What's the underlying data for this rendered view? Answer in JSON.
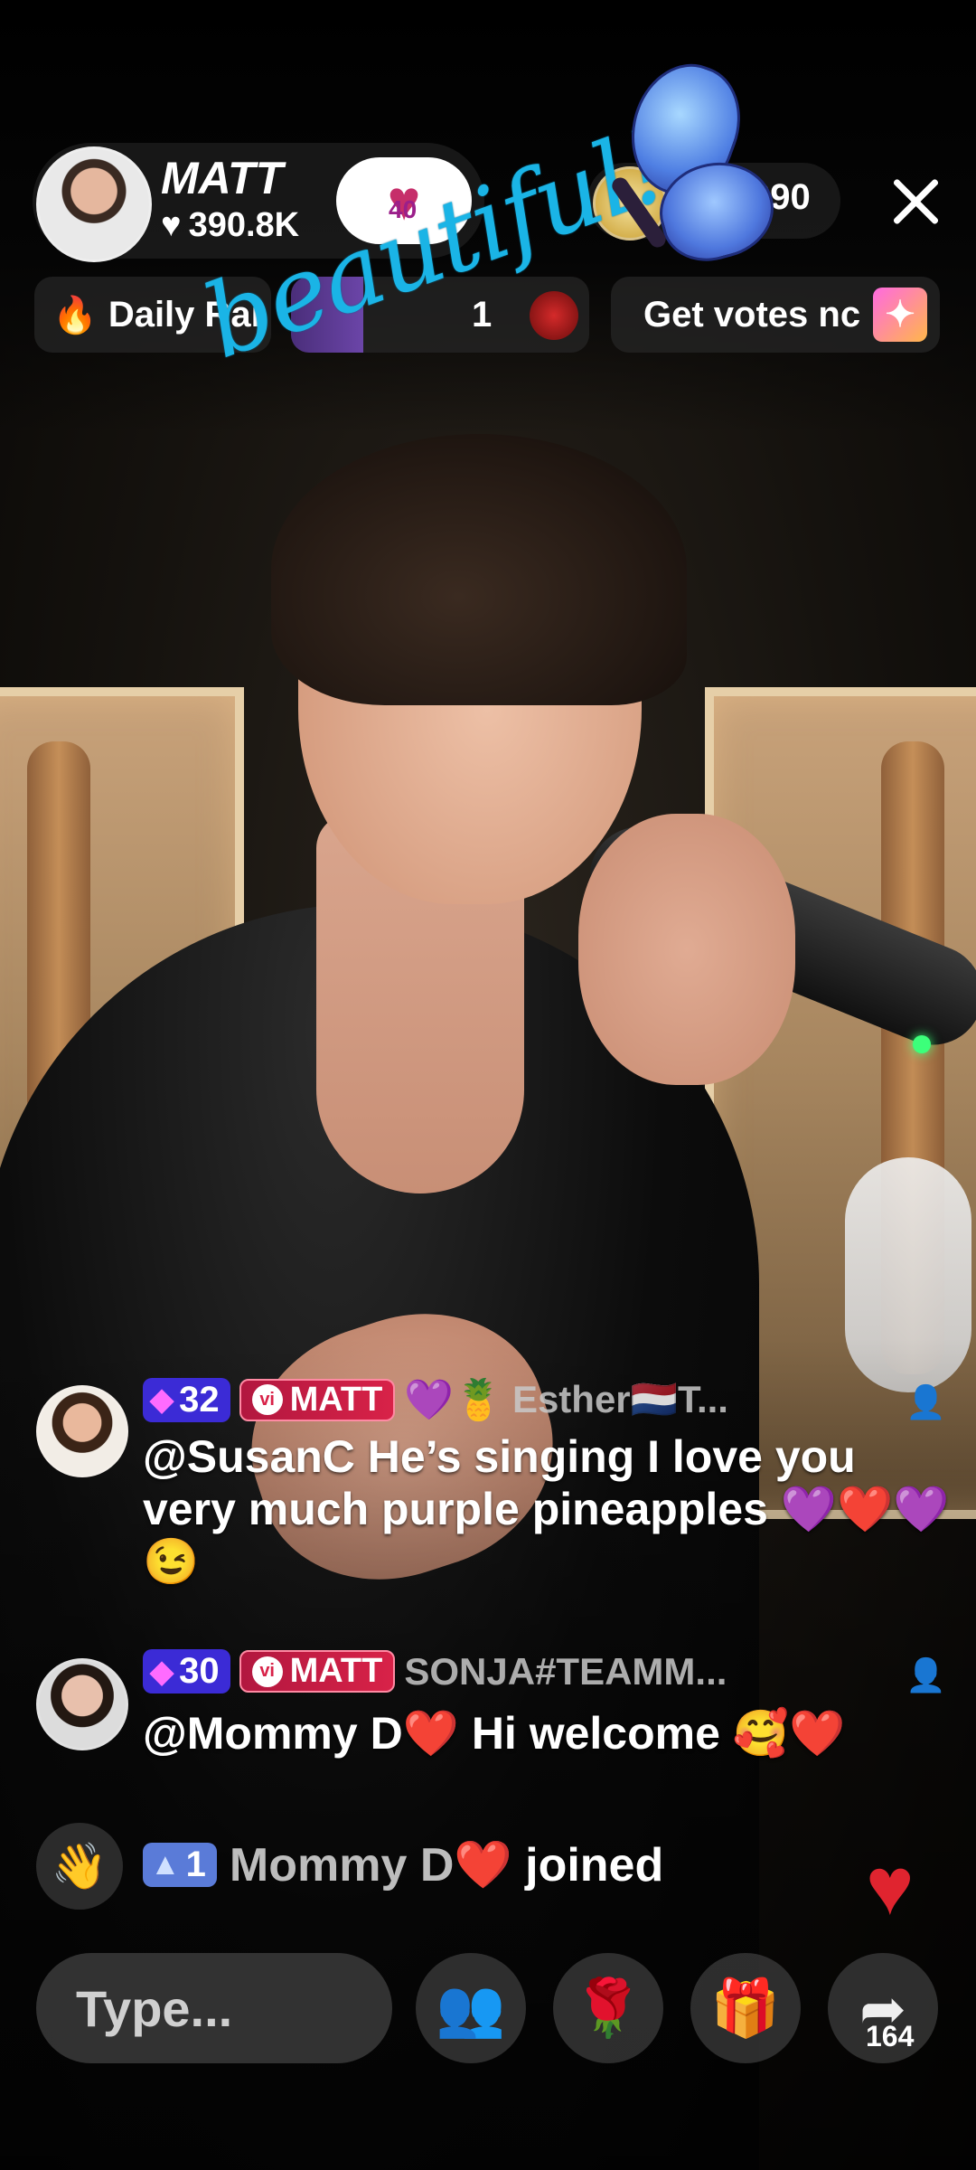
{
  "host": {
    "name": "MATT",
    "likes": "390.8K",
    "badge_level": "40"
  },
  "viewers": {
    "count": "290"
  },
  "chips": {
    "daily": "Daily Rai",
    "middle_number": "1",
    "votes": "Get votes nc"
  },
  "sticker": {
    "text": "beautiful!"
  },
  "comments": [
    {
      "level": "32",
      "fan_badge": "MATT",
      "username": "Esther🇳🇱T...",
      "prefix_emojis": "💜🍍",
      "text": "@SusanC He’s singing I love you very much purple pineapples 💜❤️💜😉"
    },
    {
      "level": "30",
      "fan_badge": "MATT",
      "username": "SONJA#TEAMM...",
      "prefix_emojis": "",
      "text": "@Mommy D❤️ Hi welcome 🥰❤️"
    }
  ],
  "join": {
    "level": "1",
    "username": "Mommy D❤️",
    "action": "joined"
  },
  "bottom": {
    "input_placeholder": "Type...",
    "share_count": "164"
  },
  "colors": {
    "accent_pink": "#ff3fb0",
    "fan_badge_red": "#d82248",
    "level_purple": "#3b2bd6",
    "sticker_blue": "#1ab4e6"
  }
}
